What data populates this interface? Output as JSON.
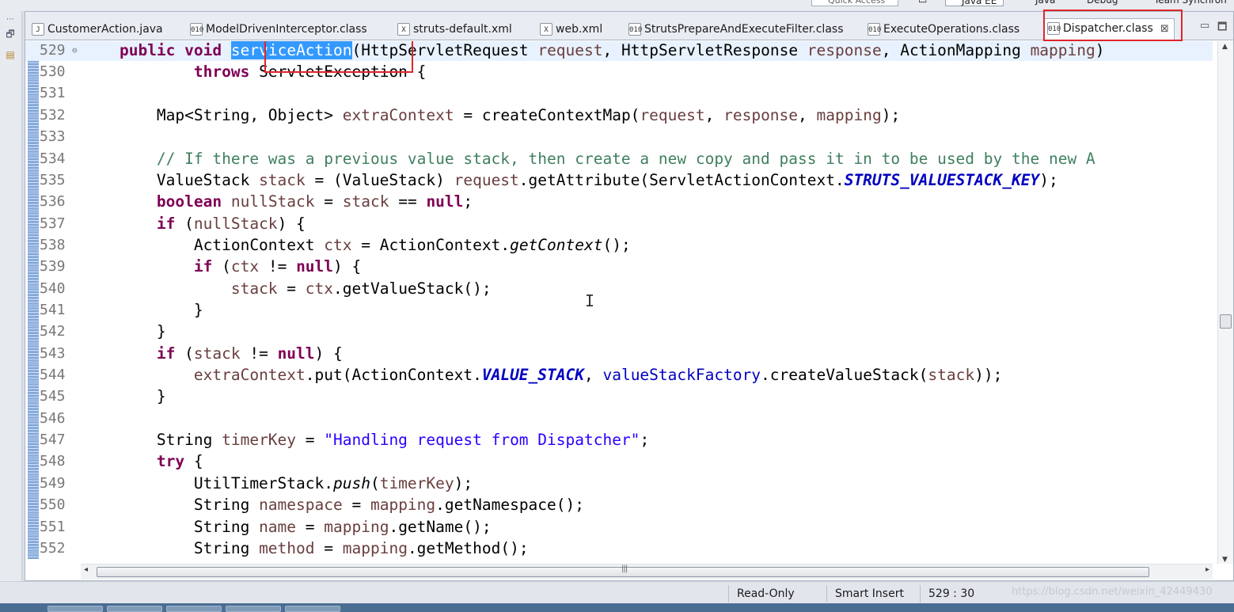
{
  "top_bar": {
    "quick_access": "Quick Access",
    "perspectives": [
      "Java EE",
      "Java",
      "Debug",
      "Team Synchron"
    ]
  },
  "tabs": [
    {
      "label": "CustomerAction.java",
      "icon": "java-file-icon"
    },
    {
      "label": "ModelDrivenInterceptor.class",
      "icon": "class-file-icon"
    },
    {
      "label": "struts-default.xml",
      "icon": "xml-file-icon"
    },
    {
      "label": "web.xml",
      "icon": "xml-file-icon"
    },
    {
      "label": "StrutsPrepareAndExecuteFilter.class",
      "icon": "class-file-icon"
    },
    {
      "label": "ExecuteOperations.class",
      "icon": "class-file-icon"
    },
    {
      "label": "Dispatcher.class",
      "icon": "class-file-icon",
      "active": true
    }
  ],
  "code": {
    "line_numbers": [
      "529",
      "530",
      "531",
      "532",
      "533",
      "534",
      "535",
      "536",
      "537",
      "538",
      "539",
      "540",
      "541",
      "542",
      "543",
      "544",
      "545",
      "546",
      "547",
      "548",
      "549",
      "550",
      "551",
      "552"
    ],
    "selected_identifier": "serviceAction"
  },
  "status": {
    "mode": "Read-Only",
    "insert": "Smart Insert",
    "position": "529 : 30",
    "watermark": "https://blog.csdn.net/weixin_42449430"
  },
  "colors": {
    "keyword": "#7f0055",
    "field": "#0000c0",
    "string": "#2a00ff",
    "comment": "#3f7f5f",
    "highlight_box": "#e0262b",
    "selection": "#3399ff"
  }
}
